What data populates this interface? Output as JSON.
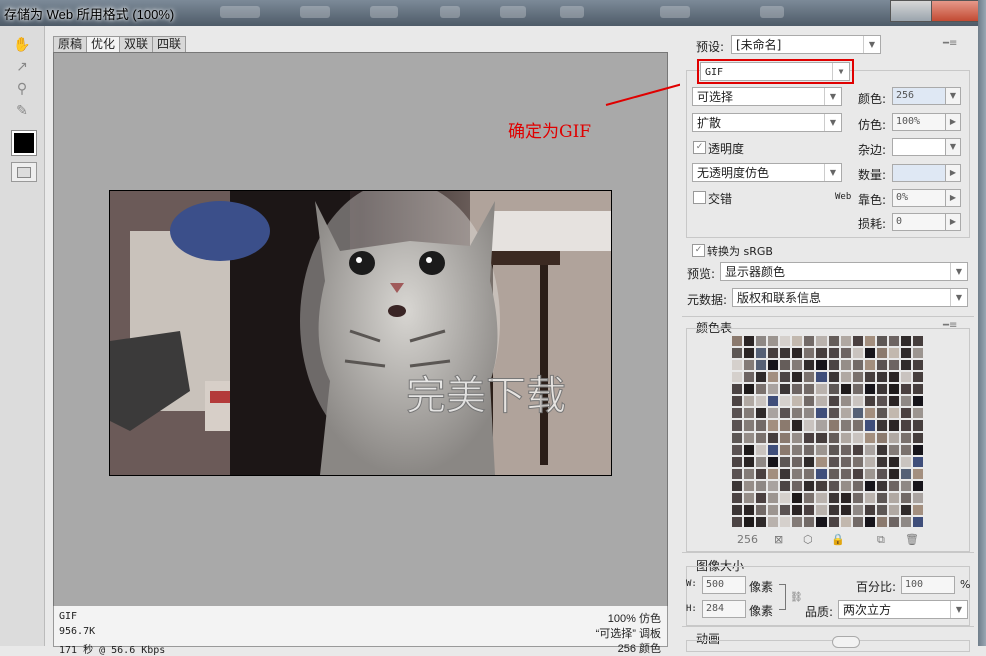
{
  "window": {
    "title": "存储为 Web 所用格式 (100%)"
  },
  "tabs": [
    "原稿",
    "优化",
    "双联",
    "四联"
  ],
  "image": {
    "watermark": "完美下载"
  },
  "status": {
    "format": "GIF",
    "size": "956.7K",
    "time": "171 秒 @ 56.6 Kbps",
    "dither_pct": "100% 仿色",
    "palette": "“可选择” 调板",
    "colors": "256 颜色"
  },
  "settings": {
    "preset_label": "预设:",
    "preset_value": "[未命名]",
    "format_value": "GIF",
    "reduction_value": "可选择",
    "dither_algo_value": "扩散",
    "transparency_label": "透明度",
    "transparency_dither_value": "无透明度仿色",
    "interlace_label": "交错",
    "colors_label": "颜色:",
    "colors_value": "256",
    "dither_label": "仿色:",
    "dither_value": "100%",
    "matte_label": "杂边:",
    "amount_label": "数量:",
    "websnap_prefix": "Web",
    "websnap_label": "靠色:",
    "websnap_value": "0%",
    "lossy_label": "损耗:",
    "lossy_value": "0",
    "convert_srgb_label": "转换为 sRGB",
    "preview_label": "预览:",
    "preview_value": "显示器颜色",
    "metadata_label": "元数据:",
    "metadata_value": "版权和联系信息"
  },
  "color_table": {
    "title": "颜色表",
    "count": "256"
  },
  "image_size": {
    "title": "图像大小",
    "w_label": "W:",
    "w_value": "500",
    "h_label": "H:",
    "h_value": "284",
    "unit": "像素",
    "percent_label": "百分比:",
    "percent_value": "100",
    "percent_unit": "%",
    "quality_label": "品质:",
    "quality_value": "两次立方"
  },
  "animation": {
    "title": "动画"
  },
  "annotation": {
    "text": "确定为GIF",
    "color": "#e00000"
  },
  "colors": {
    "accent_red": "#e00000",
    "panel_bg": "#e9e9e9",
    "canvas_bg": "#a9a9a9"
  }
}
